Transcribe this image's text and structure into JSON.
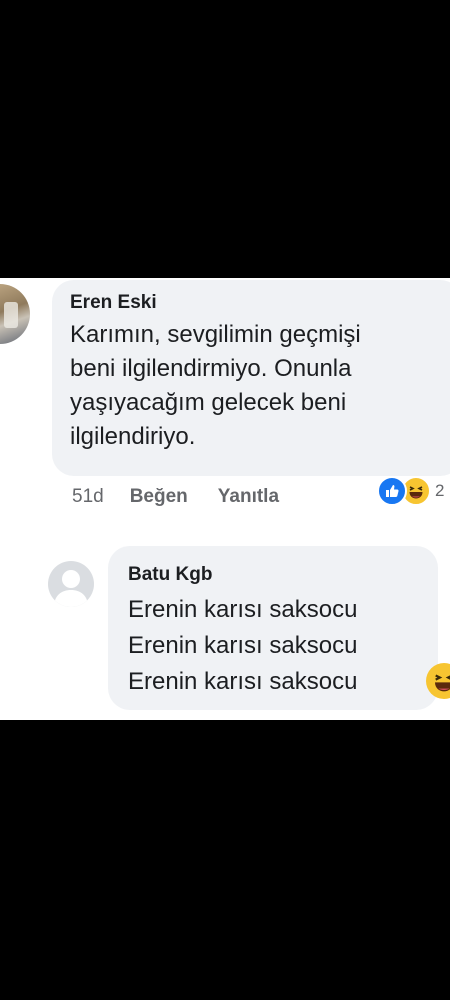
{
  "comment": {
    "author": "Eren Eski",
    "text": "Karımın, sevgilimin geçmişi\nbeni ilgilendirmiyo. Onunla\nyaşıyacağım gelecek beni\nilgilendiriyo.",
    "time": "51d",
    "like_label": "Beğen",
    "reply_label": "Yanıtla",
    "reaction_count": "2",
    "reactions": [
      "like-icon",
      "haha-icon"
    ]
  },
  "reply": {
    "author": "Batu Kgb",
    "text": "Erenin karısı saksocu\nErenin karısı saksocu\nErenin karısı saksocu",
    "emoji": "haha-emoji-icon"
  },
  "colors": {
    "background": "#000000",
    "bubble": "#f0f2f5",
    "like_blue": "#1877f2",
    "haha_yellow": "#f7c531",
    "meta_text": "#65676b"
  }
}
